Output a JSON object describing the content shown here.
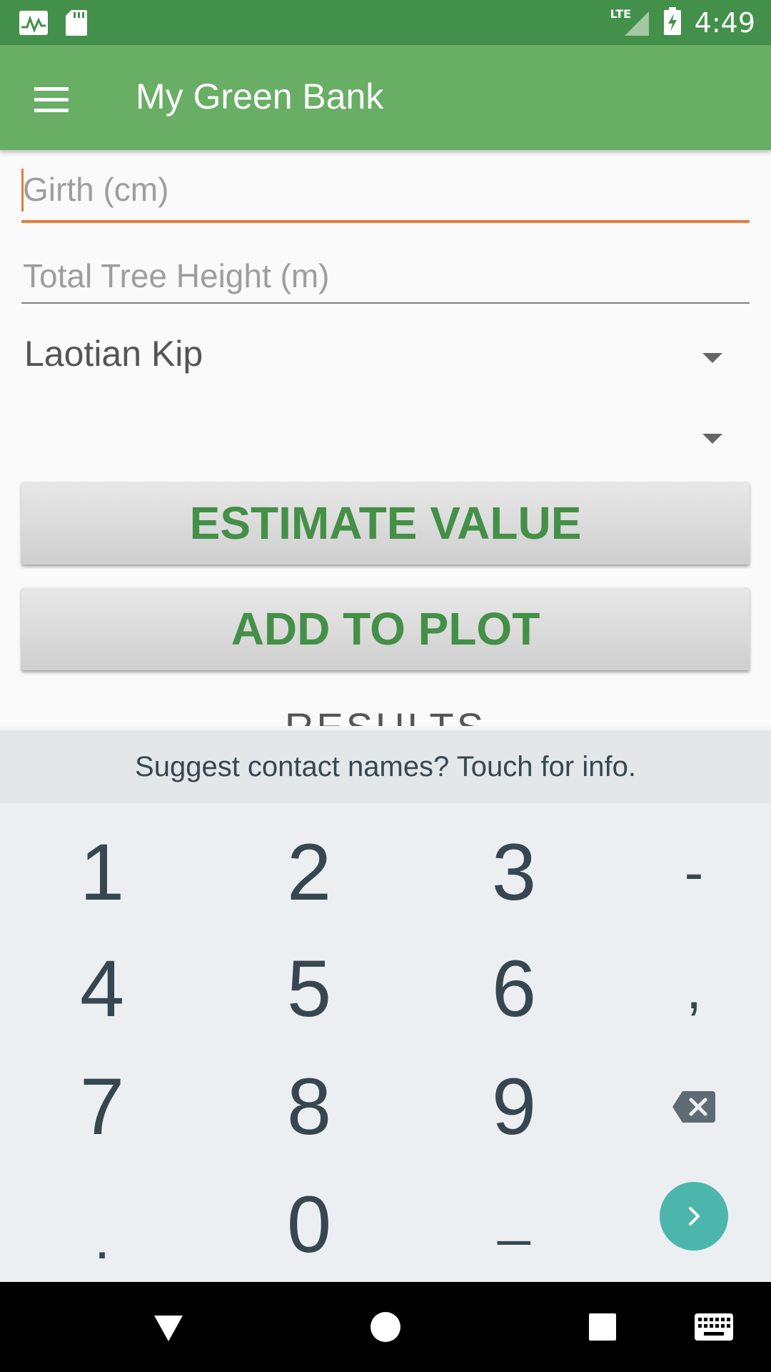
{
  "status_bar": {
    "time": "4:49",
    "network": "LTE",
    "icons": [
      "activity-icon",
      "sd-card-icon",
      "lte-signal-icon",
      "battery-charging-icon"
    ]
  },
  "app_bar": {
    "title": "My Green Bank",
    "menu_icon": "menu-icon"
  },
  "form": {
    "girth": {
      "placeholder": "Girth (cm)",
      "value": ""
    },
    "height": {
      "placeholder": "Total Tree Height (m)",
      "value": ""
    },
    "species": {
      "selected": "Laotian Kip"
    },
    "secondary_select": {
      "selected": ""
    },
    "estimate_label": "ESTIMATE VALUE",
    "add_label": "ADD TO PLOT",
    "results_label": "RESULTS"
  },
  "keyboard": {
    "suggestion": "Suggest contact names? Touch for info.",
    "keys": [
      "1",
      "2",
      "3",
      "-",
      "4",
      "5",
      "6",
      ",",
      "7",
      "8",
      "9",
      "backspace",
      ".",
      "0",
      "_",
      "go"
    ]
  },
  "nav_bar": {
    "icons": [
      "back-icon",
      "home-icon",
      "recents-icon",
      "keyboard-icon"
    ]
  },
  "colors": {
    "status_bar": "#43904a",
    "app_bar": "#68ae64",
    "accent": "#e67c3b",
    "button_text": "#439046",
    "go_button": "#4db6ac"
  }
}
